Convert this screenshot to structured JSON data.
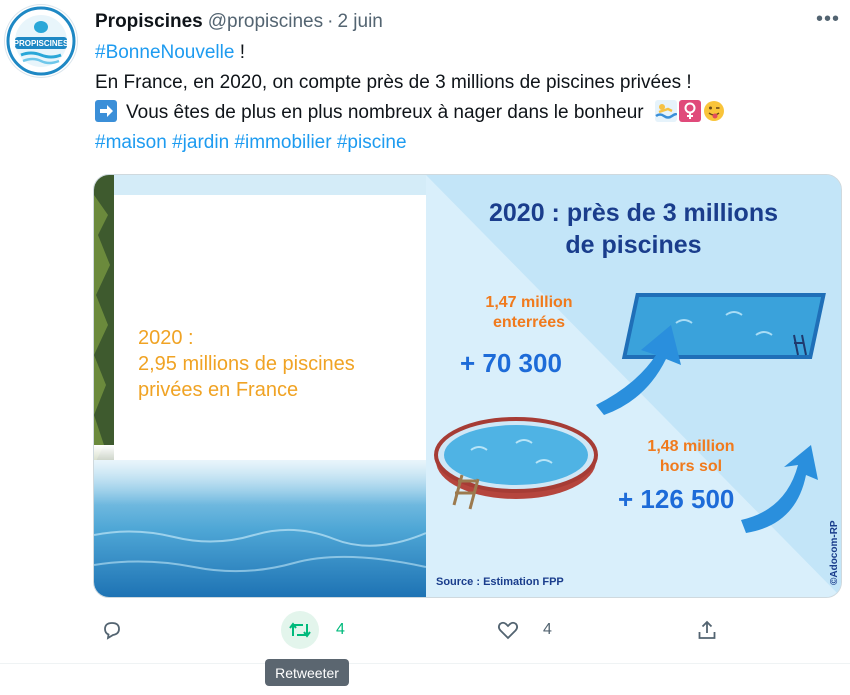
{
  "tweet": {
    "author_name": "Propiscines",
    "handle": "@propiscines",
    "separator": "·",
    "date": "2 juin",
    "avatar_logo_text": "PROPISCINES",
    "more_label": "•••",
    "line1_hashtag": "#BonneNouvelle",
    "line1_rest": " !",
    "line2": "En France, en 2020, on compte près de 3 millions de piscines privées !",
    "line3": "Vous êtes de plus en plus nombreux à nager dans le bonheur",
    "hashtags": [
      "#maison",
      "#jardin",
      "#immobilier",
      "#piscine"
    ]
  },
  "card": {
    "left_text": [
      "2020 :",
      "2,95 millions de piscines",
      "privées en France"
    ],
    "title": [
      "2020 : près de 3 millions",
      "de piscines"
    ],
    "inground_label": [
      "1,47 million",
      "enterrées"
    ],
    "inground_value": "+ 70 300",
    "aboveground_label": [
      "1,48 million",
      "hors sol"
    ],
    "aboveground_value": "+ 126 500",
    "source": "Source : Estimation FPP",
    "credit": "©Adocom-RP"
  },
  "actions": {
    "retweet_count": "4",
    "like_count": "4"
  },
  "tooltip": "Retweeter",
  "colors": {
    "link": "#1d9bf0",
    "retweet": "#00ba7c",
    "card_orange": "#f0a324",
    "card_blue": "#1a3d8c"
  },
  "icons": [
    "reply-icon",
    "retweet-icon",
    "like-icon",
    "share-icon",
    "arrow-right-icon",
    "more-icon"
  ]
}
